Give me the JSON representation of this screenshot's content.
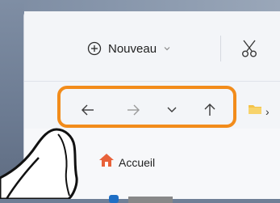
{
  "commandbar": {
    "new_label": "Nouveau",
    "new_icon": "plus-circle-icon",
    "cut_icon": "scissors-icon"
  },
  "navigation": {
    "highlight_color": "#f28c1b",
    "buttons": [
      "back-arrow-icon",
      "forward-arrow-icon",
      "recent-chevron-icon",
      "up-arrow-icon"
    ]
  },
  "sidebar": {
    "home_label": "Accueil",
    "home_icon": "home-icon"
  },
  "colors": {
    "accent": "#f28c1b",
    "folder": "#f4c34a",
    "home": "#e8623a"
  }
}
